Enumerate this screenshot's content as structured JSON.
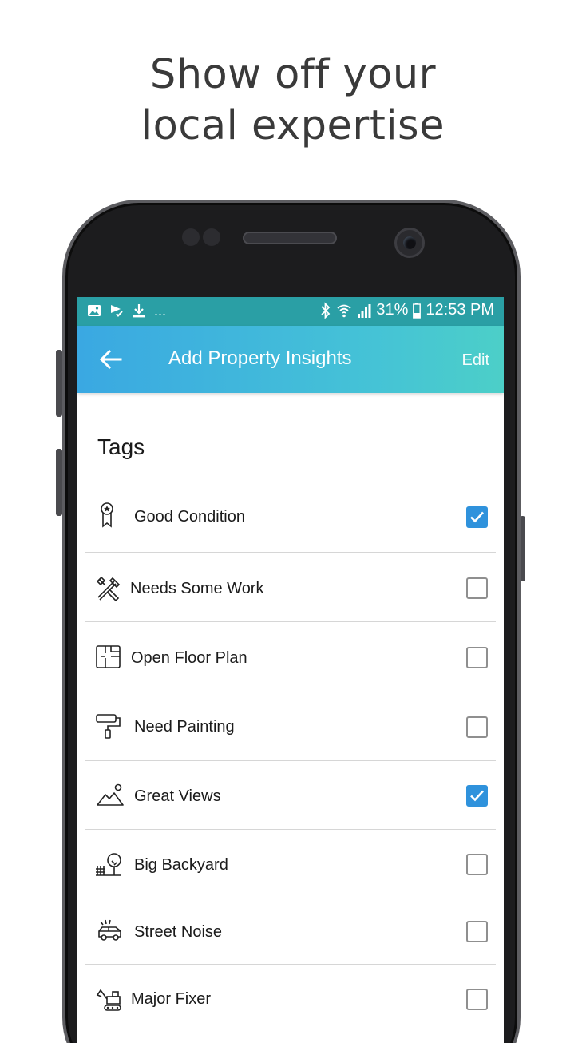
{
  "headline": {
    "line1": "Show off your",
    "line2": "local expertise"
  },
  "status_bar": {
    "battery": "31%",
    "time": "12:53 PM",
    "overflow": "..."
  },
  "app_bar": {
    "title": "Add Property Insights",
    "edit_label": "Edit"
  },
  "section": {
    "title": "Tags"
  },
  "tags": [
    {
      "label": "Good Condition",
      "icon": "ribbon-award-icon",
      "checked": true
    },
    {
      "label": "Needs Some Work",
      "icon": "tools-icon",
      "checked": false
    },
    {
      "label": "Open Floor Plan",
      "icon": "floor-plan-icon",
      "checked": false
    },
    {
      "label": "Need Painting",
      "icon": "paint-roller-icon",
      "checked": false
    },
    {
      "label": "Great Views",
      "icon": "mountain-view-icon",
      "checked": true
    },
    {
      "label": "Big Backyard",
      "icon": "backyard-tree-icon",
      "checked": false
    },
    {
      "label": "Street Noise",
      "icon": "car-noise-icon",
      "checked": false
    },
    {
      "label": "Major Fixer",
      "icon": "excavator-icon",
      "checked": false
    }
  ],
  "colors": {
    "app_bar_start": "#3aa8e2",
    "app_bar_end": "#4ccfc8",
    "status_bar": "#2a9fa5",
    "checkbox_checked": "#2f92dc"
  }
}
